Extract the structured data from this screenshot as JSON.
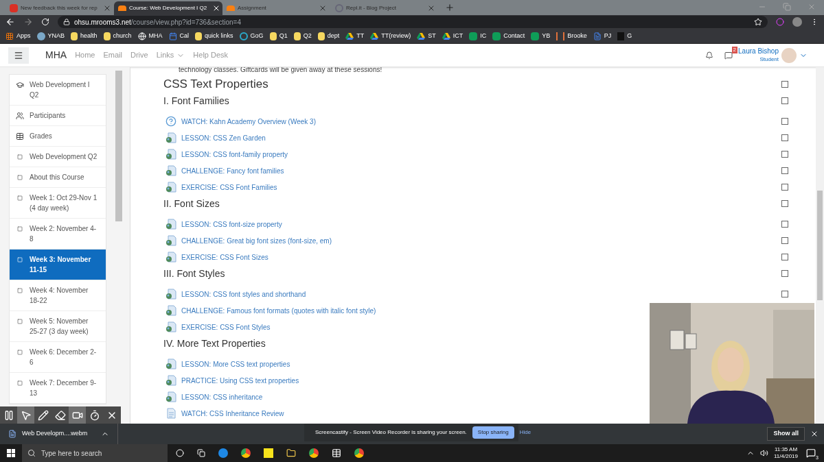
{
  "browser_tabs": [
    {
      "title": "New feedback this week for rep",
      "kind": "mail",
      "selected": false
    },
    {
      "title": "Course: Web Development I Q2",
      "kind": "moodle",
      "selected": true
    },
    {
      "title": "Assignment",
      "kind": "moodle",
      "selected": false
    },
    {
      "title": "Repl.it - Blog Project",
      "kind": "replit",
      "selected": false
    }
  ],
  "address": {
    "host": "ohsu.mrooms3.net",
    "path": "/course/view.php?id=736&section=4"
  },
  "bookmarks": [
    {
      "label": "Apps",
      "kind": "apps"
    },
    {
      "label": "YNAB",
      "kind": "tree"
    },
    {
      "label": "health",
      "kind": "folder"
    },
    {
      "label": "church",
      "kind": "folder"
    },
    {
      "label": "MHA",
      "kind": "globe"
    },
    {
      "label": "Cal",
      "kind": "calendar"
    },
    {
      "label": "quick links",
      "kind": "folder"
    },
    {
      "label": "GoG",
      "kind": "ring"
    },
    {
      "label": "Q1",
      "kind": "folder"
    },
    {
      "label": "Q2",
      "kind": "folder"
    },
    {
      "label": "dept",
      "kind": "folder"
    },
    {
      "label": "TT",
      "kind": "drive"
    },
    {
      "label": "TT(review)",
      "kind": "drive"
    },
    {
      "label": "ST",
      "kind": "drive"
    },
    {
      "label": "ICT",
      "kind": "drive"
    },
    {
      "label": "IC",
      "kind": "sheet"
    },
    {
      "label": "Contact",
      "kind": "sheet"
    },
    {
      "label": "YB",
      "kind": "sheet"
    },
    {
      "label": "Brooke",
      "kind": "brackets"
    },
    {
      "label": "PJ",
      "kind": "doc"
    },
    {
      "label": "G",
      "kind": "dark"
    }
  ],
  "navbar": {
    "brand": "MHA",
    "links": [
      {
        "label": "Home",
        "dropdown": false
      },
      {
        "label": "Email",
        "dropdown": false
      },
      {
        "label": "Drive",
        "dropdown": false
      },
      {
        "label": "Links",
        "dropdown": true
      },
      {
        "label": "Help Desk",
        "dropdown": false
      }
    ],
    "message_count": "2",
    "user_name": "Laura Bishop",
    "user_role": "Student"
  },
  "sidebar": {
    "items": [
      {
        "label": "Web Development I Q2",
        "kind": "cap",
        "selected": false
      },
      {
        "label": "Participants",
        "kind": "people",
        "selected": false
      },
      {
        "label": "Grades",
        "kind": "table",
        "selected": false
      },
      {
        "label": "Web Development Q2",
        "kind": "section",
        "selected": false
      },
      {
        "label": "About this Course",
        "kind": "section",
        "selected": false
      },
      {
        "label": "Week 1: Oct 29-Nov 1 (4 day week)",
        "kind": "section",
        "selected": false
      },
      {
        "label": "Week 2: November 4-8",
        "kind": "section",
        "selected": false
      },
      {
        "label": "Week 3: November 11-15",
        "kind": "section",
        "selected": true
      },
      {
        "label": "Week 4: November 18-22",
        "kind": "section",
        "selected": false
      },
      {
        "label": "Week 5: November 25-27 (3 day week)",
        "kind": "section",
        "selected": false
      },
      {
        "label": "Week 6: December 2-6",
        "kind": "section",
        "selected": false
      },
      {
        "label": "Week 7: December 9-13",
        "kind": "section",
        "selected": false
      }
    ]
  },
  "content": {
    "intro": "technology classes. Giftcards will be given away at these sessions!",
    "title": "CSS Text Properties",
    "title_checked": false,
    "sections": [
      {
        "heading": "I. Font Families",
        "checked": false,
        "activities": [
          {
            "label": "WATCH: Kahn Academy Overview (Week 3)",
            "kind": "question",
            "checked": false
          },
          {
            "label": "LESSON: CSS Zen Garden",
            "kind": "page",
            "checked": false
          },
          {
            "label": "LESSON: CSS font-family property",
            "kind": "page",
            "checked": false
          },
          {
            "label": "CHALLENGE: Fancy font families",
            "kind": "page",
            "checked": false
          },
          {
            "label": "EXERCISE: CSS Font Families",
            "kind": "page",
            "checked": false
          }
        ]
      },
      {
        "heading": "II. Font Sizes",
        "checked": false,
        "activities": [
          {
            "label": "LESSON: CSS font-size property",
            "kind": "page",
            "checked": false
          },
          {
            "label": "CHALLENGE: Great big font sizes (font-size, em)",
            "kind": "page",
            "checked": false
          },
          {
            "label": "EXERCISE: CSS Font Sizes",
            "kind": "page",
            "checked": false
          }
        ]
      },
      {
        "heading": "III. Font Styles",
        "checked": false,
        "activities": [
          {
            "label": "LESSON: CSS font styles and shorthand",
            "kind": "page",
            "checked": false
          },
          {
            "label": "CHALLENGE: Famous font formats (quotes with italic font style)",
            "kind": "page"
          },
          {
            "label": "EXERCISE: CSS Font Styles",
            "kind": "page"
          }
        ]
      },
      {
        "heading": "IV. More Text Properties",
        "activities": [
          {
            "label": "LESSON: More CSS text properties",
            "kind": "page"
          },
          {
            "label": "PRACTICE: Using CSS text properties",
            "kind": "page"
          },
          {
            "label": "LESSON: CSS inheritance",
            "kind": "page"
          },
          {
            "label": "WATCH: CSS Inheritance Review",
            "kind": "doc"
          }
        ]
      }
    ]
  },
  "recorder_tools": [
    {
      "kind": "pause",
      "selected": false
    },
    {
      "kind": "pointer",
      "selected": true
    },
    {
      "kind": "pen",
      "selected": false
    },
    {
      "kind": "eraser",
      "selected": false
    },
    {
      "kind": "camera",
      "selected": true
    },
    {
      "kind": "timer",
      "selected": false
    },
    {
      "kind": "close",
      "selected": false
    }
  ],
  "download_bar": {
    "file": "Web Developm....webm",
    "show_all": "Show all"
  },
  "share_notice": {
    "message": "Screencastify - Screen Video Recorder is sharing your screen.",
    "stop": "Stop sharing",
    "hide": "Hide"
  },
  "taskbar": {
    "search_placeholder": "Type here to search",
    "time": "11:35 AM",
    "date": "11/4/2019",
    "notification_count": "3"
  }
}
